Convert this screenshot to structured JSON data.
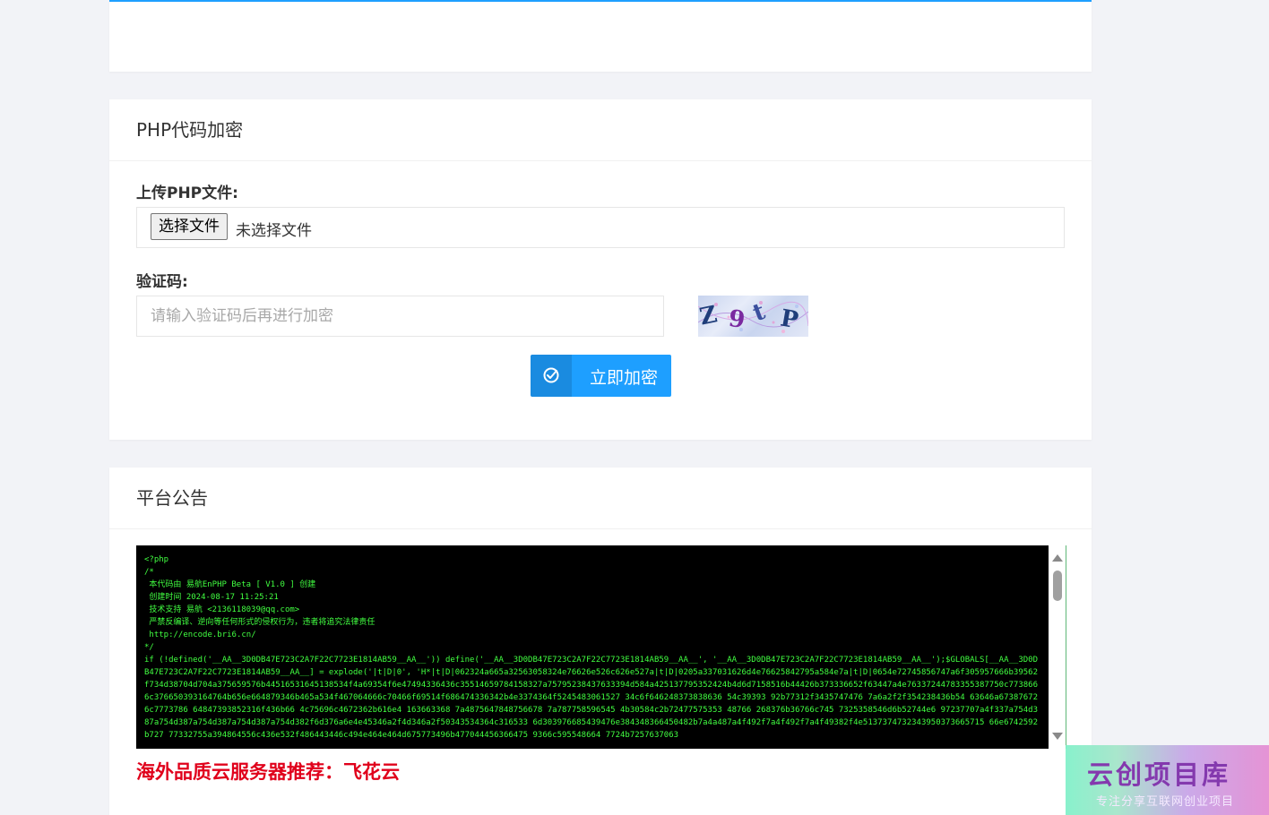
{
  "colors": {
    "accent": "#1e9fff",
    "promo": "#e0001b",
    "code_bg": "#000000",
    "code_fg": "#41ff41"
  },
  "encrypt_card": {
    "title": "PHP代码加密",
    "upload_label": "上传PHP文件:",
    "file_button": "选择文件",
    "file_status": "未选择文件",
    "captcha_label": "验证码:",
    "captcha_placeholder": "请输入验证码后再进行加密",
    "captcha_value": "",
    "captcha_chars": [
      "Z",
      "9",
      "t",
      "P"
    ],
    "submit_icon": "check-circle-icon",
    "submit_label": "立即加密"
  },
  "notice_card": {
    "title": "平台公告",
    "code": "<?php\n/*\n 本代码由 易航EnPHP Beta [ V1.0 ] 创建\n 创建时间 2024-08-17 11:25:21\n 技术支持 易航 <2136118039@qq.com>\n 严禁反编译、逆向等任何形式的侵权行为，违者将追究法律责任\n http://encode.bri6.cn/\n*/\nif (!defined('__AA__3D0DB47E723C2A7F22C7723E1814AB59__AA__')) define('__AA__3D0DB47E723C2A7F22C7723E1814AB59__AA__', '__AA__3D0DB47E723C2A7F22C7723E1814AB59__AA__');$GLOBALS[__AA__3D0DB47E723C2A7F22C7723E1814AB59__AA__] = explode('|t|D|0', 'H*|t|D|062324a665a32563058324e76626e526c626e527a|t|D|0205a337031626d4e76625842795a584e7a|t|D|0654e72745856747a6f305957666b39562f734d38704d704a375659576b44516531645138534f4a69354f6e47494336436c35514659784158327a75795238437633394d584a425137795352424b4d6d7158516b44426b373336652f63447a4e76337244783355387750c7738666c376650393164764b656e664879346b465a534f467064666c70466f69514f686474336342b4e3374364f5245483061527 34c6f646248373838636 54c39393 92b77312f3435747476 7a6a2f2f354238436b54 63646a673876726c7773786 64847393852316f436b66 4c75696c4672362b616e4 163663368 7a4875647848756678 7a787758596545 4b30584c2b72477575353 48766 268376b36766c745 7325358546d6b52744e6 97237707a4f337a754d387a754d387a754d387a754d387a754d382f6d376a6e4e45346a2f4d346a2f50343534364c316533 6d303976685439476e384348366450482b7a4a487a4f492f7a4f492f7a4f49382f4e5137374732343950373665715 66e6742592b727 77332755a394864556c436e532f486443446c494e464e464d675773496b477044456366475 9366c595548664 7724b7257637063"
  },
  "promo": {
    "text": "海外品质云服务器推荐：飞花云"
  },
  "watermark": {
    "title": "云创项目库",
    "subtitle": "专注分享互联网创业项目"
  }
}
